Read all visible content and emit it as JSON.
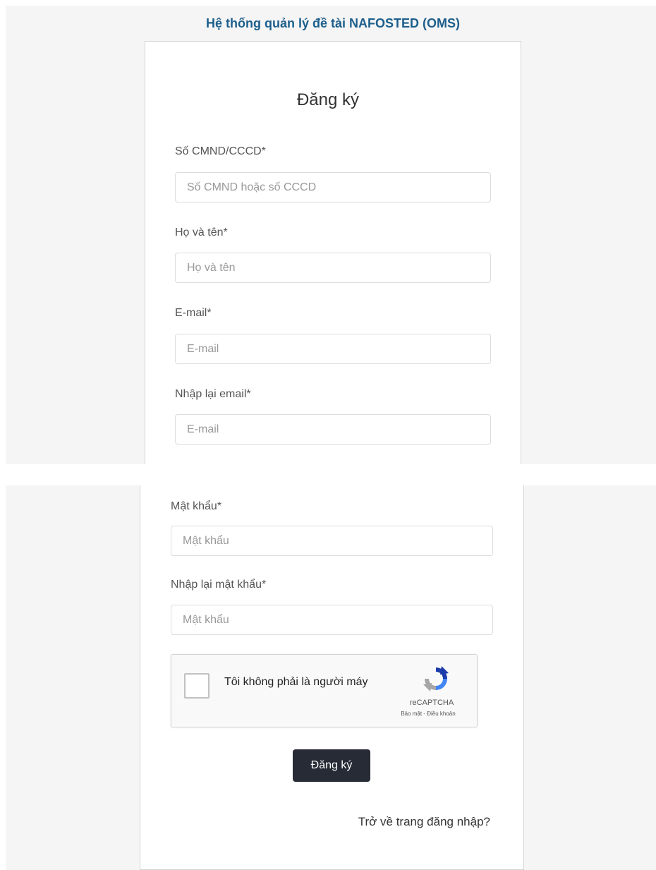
{
  "header": {
    "app_title": "Hệ thống quản lý đề tài NAFOSTED (OMS)"
  },
  "form": {
    "title": "Đăng ký",
    "id_number": {
      "label": "Số CMND/CCCD*",
      "placeholder": "Số CMND hoặc số CCCD",
      "value": ""
    },
    "full_name": {
      "label": "Họ và tên*",
      "placeholder": "Họ và tên",
      "value": ""
    },
    "email": {
      "label": "E-mail*",
      "placeholder": "E-mail",
      "value": ""
    },
    "email_confirm": {
      "label": "Nhập lại email*",
      "placeholder": "E-mail",
      "value": ""
    },
    "password": {
      "label": "Mật khẩu*",
      "placeholder": "Mật khẩu",
      "value": ""
    },
    "password_confirm": {
      "label": "Nhập lại mật khẩu*",
      "placeholder": "Mật khẩu",
      "value": ""
    },
    "submit_label": "Đăng ký",
    "back_link": "Trở về trang đăng nhập?"
  },
  "recaptcha": {
    "checkbox_label": "Tôi không phải là người máy",
    "brand": "reCAPTCHA",
    "links": "Bảo mật - Điều khoản",
    "icon": "recaptcha-icon",
    "checked": false
  },
  "colors": {
    "title": "#1d5f8c",
    "button": "#262b35",
    "background": "#f5f5f5"
  }
}
